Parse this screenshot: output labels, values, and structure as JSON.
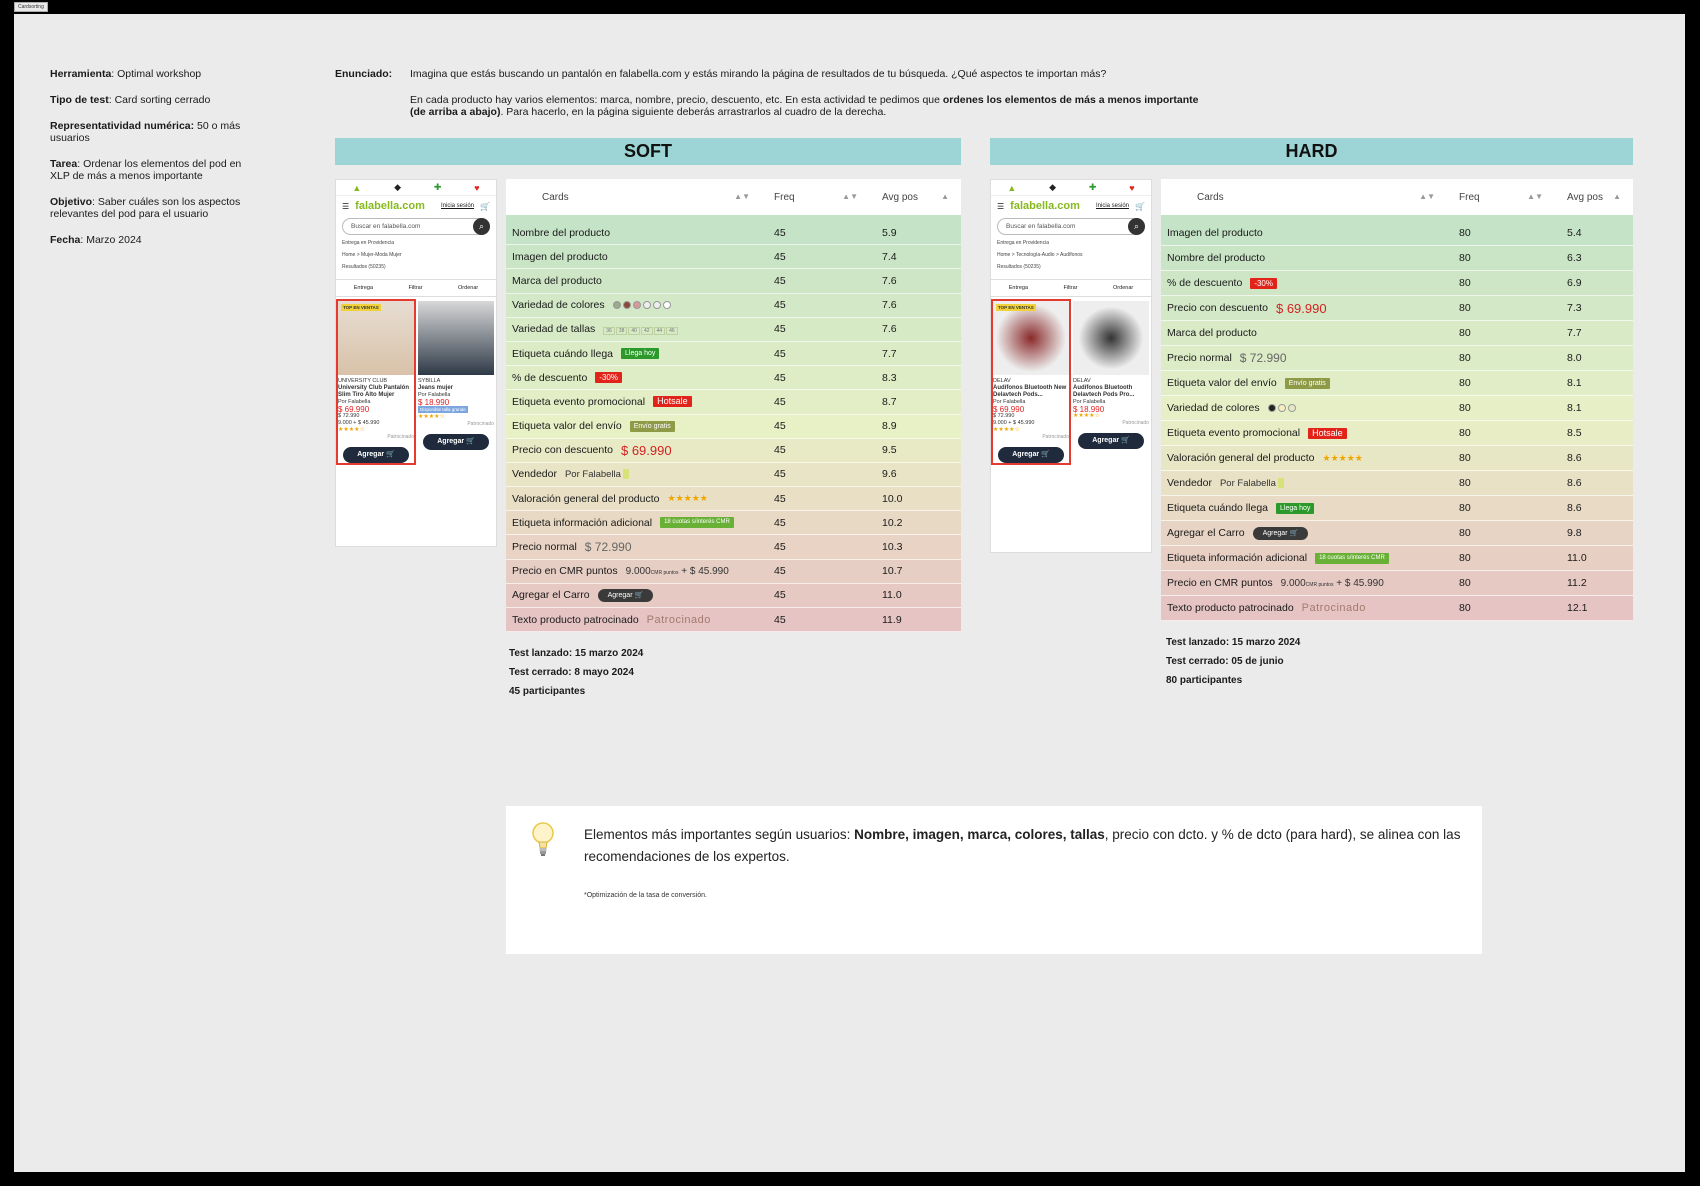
{
  "frame_label": "Cardsorting",
  "meta": [
    {
      "label": "Herramienta",
      "value": ": Optimal workshop"
    },
    {
      "label": "Tipo de test",
      "value": ": Card sorting cerrado"
    },
    {
      "label": "Representatividad numérica:",
      "value": " 50 o más usuarios"
    },
    {
      "label": "Tarea",
      "value": ": Ordenar los elementos del pod en XLP de más a menos importante"
    },
    {
      "label": "Objetivo",
      "value": ": Saber cuáles son los aspectos relevantes del pod para el usuario"
    },
    {
      "label": "Fecha",
      "value": ": Marzo 2024"
    }
  ],
  "enunciado": {
    "label": "Enunciado:",
    "p1": "Imagina que estás buscando un pantalón en falabella.com y estás mirando la página de resultados de tu búsqueda. ¿Qué aspectos te importan más?",
    "p2a": "En cada producto hay varios elementos: marca, nombre, precio, descuento, etc. En esta actividad te pedimos que ",
    "p2b": "ordenes los elementos de más a menos importante (de arriba a abajo)",
    "p2c": ". Para hacerlo, en la página siguiente deberás arrastrarlos al cuadro de la derecha."
  },
  "header": {
    "cards": "Cards",
    "freq": "Freq",
    "avg": "Avg pos"
  },
  "chips": {
    "llega_hoy": "Llega hoy",
    "hotsale": "Hotsale",
    "envio": "Envío gratis",
    "desc": "-30%",
    "cmr": "18 cuotas s/interés CMR",
    "agregar": "Agregar",
    "vendor": "Por Falabella",
    "price_desc": "$ 69.990",
    "price_normal": "$ 72.990",
    "cmr_pts": "9.000",
    "cmr_pts_word": "CMR puntos",
    "cmr_pts_plus": "+ $ 45.990",
    "patrocinado": "Patrocinado",
    "stars": "★★★★★",
    "tallas": [
      "36",
      "38",
      "40",
      "42",
      "44",
      "46"
    ]
  },
  "soft": {
    "title": "SOFT",
    "rows": [
      {
        "card": "Nombre del producto",
        "freq": "45",
        "avg": "5.9",
        "extra": ""
      },
      {
        "card": "Imagen del producto",
        "freq": "45",
        "avg": "7.4",
        "extra": ""
      },
      {
        "card": "Marca del producto",
        "freq": "45",
        "avg": "7.6",
        "extra": ""
      },
      {
        "card": "Variedad de colores",
        "freq": "45",
        "avg": "7.6",
        "extra": "dots"
      },
      {
        "card": "Variedad de tallas",
        "freq": "45",
        "avg": "7.6",
        "extra": "tallas"
      },
      {
        "card": "Etiqueta cuándo llega",
        "freq": "45",
        "avg": "7.7",
        "extra": "llega"
      },
      {
        "card": "% de descuento",
        "freq": "45",
        "avg": "8.3",
        "extra": "desc"
      },
      {
        "card": "Etiqueta evento promocional",
        "freq": "45",
        "avg": "8.7",
        "extra": "hotsale"
      },
      {
        "card": "Etiqueta valor del envío",
        "freq": "45",
        "avg": "8.9",
        "extra": "envio"
      },
      {
        "card": "Precio con descuento",
        "freq": "45",
        "avg": "9.5",
        "extra": "pdesc"
      },
      {
        "card": "Vendedor",
        "freq": "45",
        "avg": "9.6",
        "extra": "vendor"
      },
      {
        "card": "Valoración general del producto",
        "freq": "45",
        "avg": "10.0",
        "extra": "stars"
      },
      {
        "card": "Etiqueta información adicional",
        "freq": "45",
        "avg": "10.2",
        "extra": "cmr"
      },
      {
        "card": "Precio normal",
        "freq": "45",
        "avg": "10.3",
        "extra": "pnormal"
      },
      {
        "card": "Precio en CMR puntos",
        "freq": "45",
        "avg": "10.7",
        "extra": "cmrpts"
      },
      {
        "card": "Agregar el Carro",
        "freq": "45",
        "avg": "11.0",
        "extra": "agregar"
      },
      {
        "card": "Texto producto patrocinado",
        "freq": "45",
        "avg": "11.9",
        "extra": "patroc"
      }
    ],
    "info": [
      "Test lanzado: 15 marzo 2024",
      "Test cerrado: 8 mayo 2024",
      "45 participantes"
    ],
    "phone": {
      "logo": "falabella.com",
      "login": "Inicia sesión",
      "search": "Buscar en falabella.com",
      "entrega": "Entrega en Providencia",
      "crumb": "Home > Mujer-Moda Mujer",
      "resultados": "Resultados (50235)",
      "filters": [
        "Entrega",
        "Filtrar",
        "Ordenar"
      ],
      "p1": {
        "top": "TOP EN VENTAS",
        "brand": "UNIVERSITY CLUB",
        "name": "University Club Pantalón Slim Tiro Alto Mujer",
        "seller": "Por Falabella",
        "price": "$ 69.990",
        "old": "$ 72.990",
        "cmr_price": "9.000 + $ 45.990",
        "btn": "Agregar",
        "sponsored": "Patrocinado"
      },
      "p2": {
        "brand": "SYBILLA",
        "name": "Jeans mujer",
        "seller": "Por Falabella",
        "price": "$ 18.990",
        "tag": "Disponible talla grande",
        "btn": "Agregar",
        "sponsored": "Patrocinado"
      }
    }
  },
  "hard": {
    "title": "HARD",
    "rows": [
      {
        "card": "Imagen del producto",
        "freq": "80",
        "avg": "5.4",
        "extra": ""
      },
      {
        "card": "Nombre del producto",
        "freq": "80",
        "avg": "6.3",
        "extra": ""
      },
      {
        "card": "% de descuento",
        "freq": "80",
        "avg": "6.9",
        "extra": "desc"
      },
      {
        "card": "Precio con descuento",
        "freq": "80",
        "avg": "7.3",
        "extra": "pdesc"
      },
      {
        "card": "Marca del producto",
        "freq": "80",
        "avg": "7.7",
        "extra": ""
      },
      {
        "card": "Precio normal",
        "freq": "80",
        "avg": "8.0",
        "extra": "pnormal"
      },
      {
        "card": "Etiqueta valor del envío",
        "freq": "80",
        "avg": "8.1",
        "extra": "envio"
      },
      {
        "card": "Variedad de colores",
        "freq": "80",
        "avg": "8.1",
        "extra": "dots3"
      },
      {
        "card": "Etiqueta evento promocional",
        "freq": "80",
        "avg": "8.5",
        "extra": "hotsale"
      },
      {
        "card": "Valoración general del producto",
        "freq": "80",
        "avg": "8.6",
        "extra": "stars"
      },
      {
        "card": "Vendedor",
        "freq": "80",
        "avg": "8.6",
        "extra": "vendor"
      },
      {
        "card": "Etiqueta cuándo llega",
        "freq": "80",
        "avg": "8.6",
        "extra": "llega"
      },
      {
        "card": "Agregar el Carro",
        "freq": "80",
        "avg": "9.8",
        "extra": "agregar"
      },
      {
        "card": "Etiqueta información adicional",
        "freq": "80",
        "avg": "11.0",
        "extra": "cmr"
      },
      {
        "card": "Precio en CMR puntos",
        "freq": "80",
        "avg": "11.2",
        "extra": "cmrpts"
      },
      {
        "card": "Texto producto patrocinado",
        "freq": "80",
        "avg": "12.1",
        "extra": "patroc"
      }
    ],
    "info": [
      "Test lanzado: 15 marzo 2024",
      "Test cerrado: 05 de junio",
      "80 participantes"
    ],
    "phone": {
      "logo": "falabella.com",
      "login": "Inicia sesión",
      "search": "Buscar en falabella.com",
      "entrega": "Entrega en Providencia",
      "crumb": "Home > Tecnología-Audio > Audífonos",
      "resultados": "Resultados (50235)",
      "filters": [
        "Entrega",
        "Filtrar",
        "Ordenar"
      ],
      "p1": {
        "top": "TOP EN VENTAS",
        "brand": "DELAV",
        "name": "Audífonos Bluetooth New Delavtech Pods...",
        "seller": "Por Falabella",
        "price": "$ 69.990",
        "old": "$ 72.990",
        "cmr_price": "9.000 + $ 45.990",
        "btn": "Agregar",
        "sponsored": "Patrocinado"
      },
      "p2": {
        "brand": "DELAV",
        "name": "Audífonos Bluetooth Delavtech Pods Pro...",
        "seller": "Por Falabella",
        "price": "$ 18.990",
        "tag": "",
        "btn": "Agregar",
        "sponsored": "Patrocinado"
      }
    }
  },
  "insight": {
    "a": "Elementos más importantes según usuarios: ",
    "b": "Nombre, imagen, marca, colores, tallas",
    "c": ", precio con dcto. y % de dcto (para hard), se alinea con las recomendaciones de los expertos.",
    "foot": "*Optimización de la tasa de conversión."
  },
  "colors": {
    "banner": "#9dd5d6",
    "row_top": "#c5e3c6",
    "row_mid": "#e8f0c6",
    "row_bot": "#e6c4c4",
    "red": "#e2231a"
  }
}
